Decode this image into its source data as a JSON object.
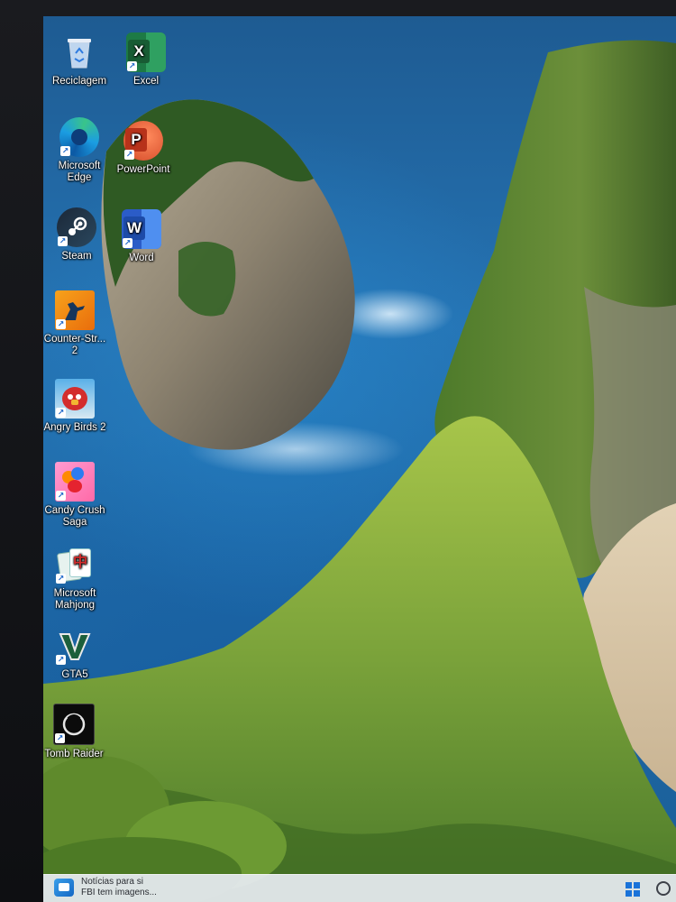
{
  "desktop": {
    "icons": [
      {
        "label": "Reciclagem",
        "icon": "recycle-bin-icon"
      },
      {
        "label": "Excel",
        "icon": "excel-icon"
      },
      {
        "label": "Microsoft Edge",
        "icon": "edge-icon"
      },
      {
        "label": "PowerPoint",
        "icon": "powerpoint-icon"
      },
      {
        "label": "Steam",
        "icon": "steam-icon"
      },
      {
        "label": "Word",
        "icon": "word-icon"
      },
      {
        "label": "Counter-Str... 2",
        "icon": "counter-strike-icon"
      },
      {
        "label": "Angry Birds 2",
        "icon": "angry-birds-icon"
      },
      {
        "label": "Candy Crush Saga",
        "icon": "candy-crush-icon"
      },
      {
        "label": "Microsoft Mahjong",
        "icon": "mahjong-icon"
      },
      {
        "label": "GTA5",
        "icon": "gta5-icon"
      },
      {
        "label": "Tomb Raider",
        "icon": "tomb-raider-icon"
      }
    ]
  },
  "taskbar": {
    "news_line1": "Notícias para si",
    "news_line2": "FBI tem imagens..."
  },
  "colors": {
    "excel": "#1d7a45",
    "powerpoint": "#d24726",
    "word": "#2b5cc7",
    "edge": "#1b9de2",
    "steam": "#1b2838",
    "windows": "#1a73d9"
  }
}
